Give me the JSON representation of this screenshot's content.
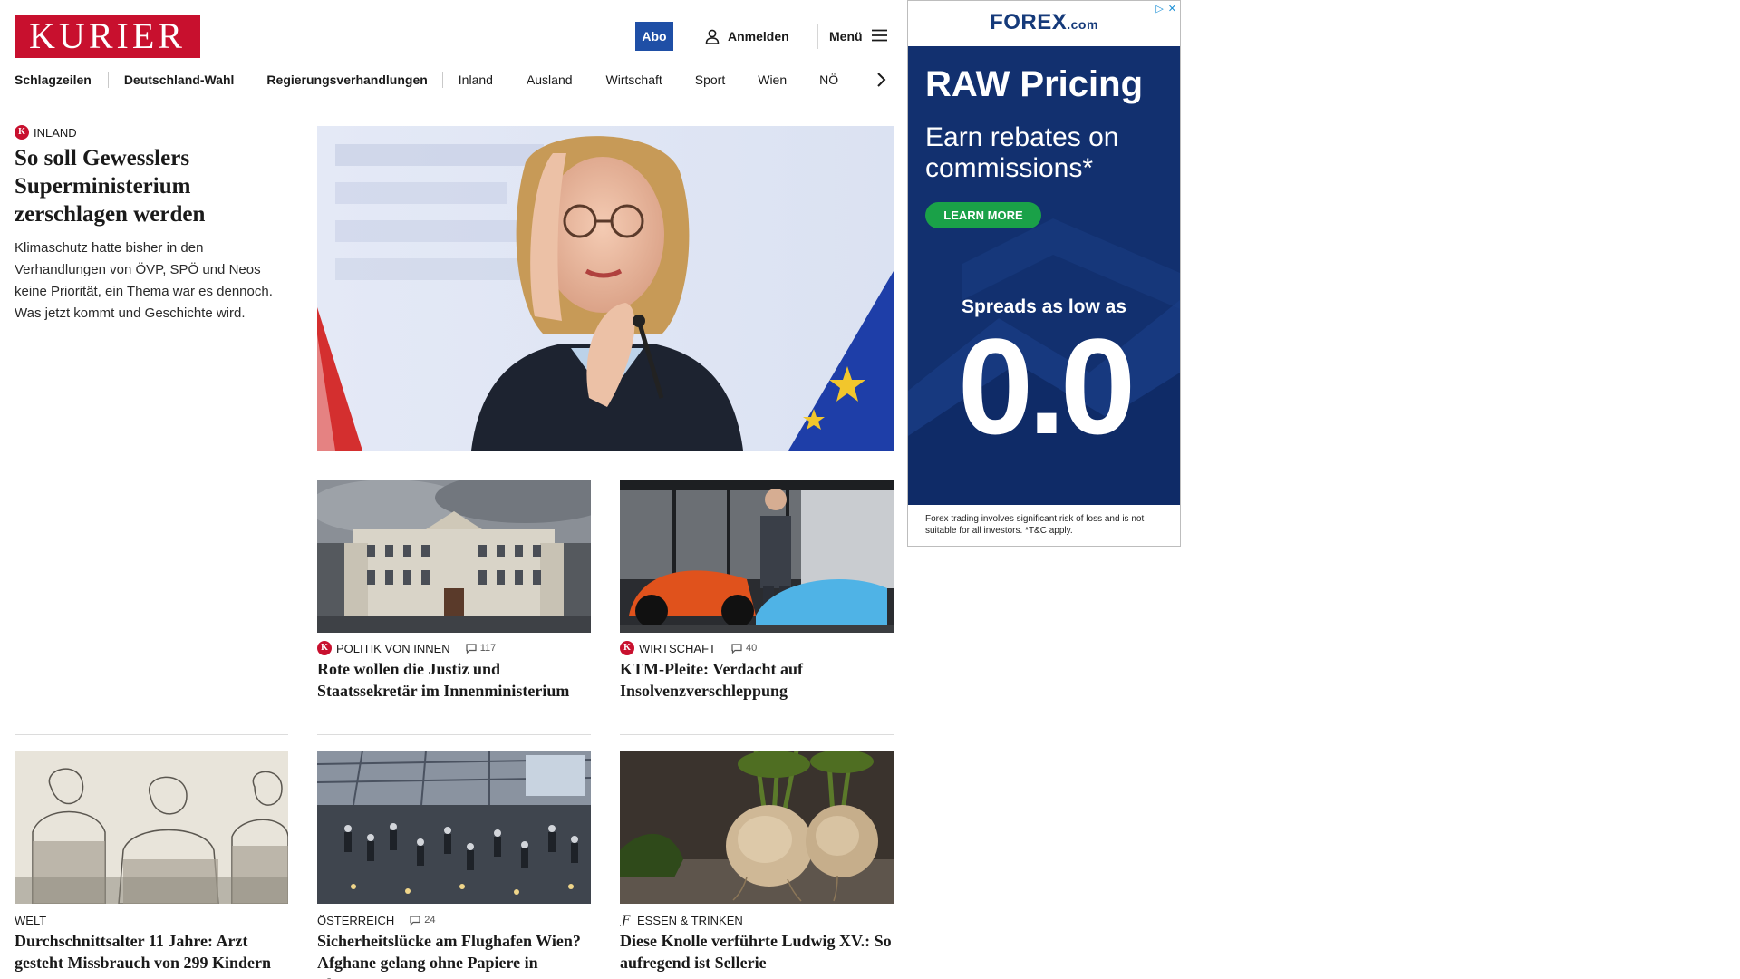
{
  "header": {
    "logo": "KURIER",
    "abo_label": "Abo",
    "login_label": "Anmelden",
    "menu_label": "Menü"
  },
  "nav": {
    "items": [
      "Schlagzeilen",
      "Deutschland-Wahl",
      "Regierungsverhandlungen",
      "Inland",
      "Ausland",
      "Wirtschaft",
      "Sport",
      "Wien",
      "NÖ"
    ]
  },
  "lead": {
    "kicker": "INLAND",
    "title": "So soll Gewesslers Superministerium zerschlagen werden",
    "teaser": "Klimaschutz hatte bisher in den Verhandlungen von ÖVP, SPÖ und Neos keine Priorität, ein Thema war es dennoch. Was jetzt kommt und Geschichte wird.",
    "image_alt": "Leonore Gewessler bei einer Pressekonferenz"
  },
  "teasers": [
    {
      "kicker": "POLITIK VON INNEN",
      "comments": "117",
      "title": "Rote wollen die Justiz und Staatssekretär im Innenministerium",
      "icon": "kurier-k"
    },
    {
      "kicker": "WIRTSCHAFT",
      "comments": "40",
      "title": "KTM-Pleite: Verdacht auf Insolvenzverschleppung",
      "icon": "kurier-k"
    },
    {
      "kicker": "WELT",
      "comments": "",
      "title": "Durchschnittsalter 11 Jahre: Arzt gesteht Missbrauch von 299 Kindern",
      "icon": ""
    },
    {
      "kicker": "ÖSTERREICH",
      "comments": "24",
      "title": "Sicherheitslücke am Flughafen Wien? Afghane gelang ohne Papiere in Flugzeug",
      "icon": ""
    },
    {
      "kicker": "ESSEN & TRINKEN",
      "comments": "",
      "title": "Diese Knolle verführte Ludwig XV.: So aufregend ist Sellerie",
      "icon": "f-icon"
    }
  ],
  "ad": {
    "brand": "FOREX",
    "brand_suffix": ".com",
    "headline": "RAW Pricing",
    "subline": "Earn rebates on commissions*",
    "cta": "LEARN MORE",
    "spreads": "Spreads as low as",
    "big_value": "0.0",
    "disclaimer": "Forex trading involves significant risk of loss and is not suitable for all investors. *T&C apply."
  },
  "colors": {
    "brand_red": "#c8102e",
    "abo_blue": "#1f4fa6",
    "ad_navy": "#12306f",
    "ad_green": "#1aa148"
  }
}
